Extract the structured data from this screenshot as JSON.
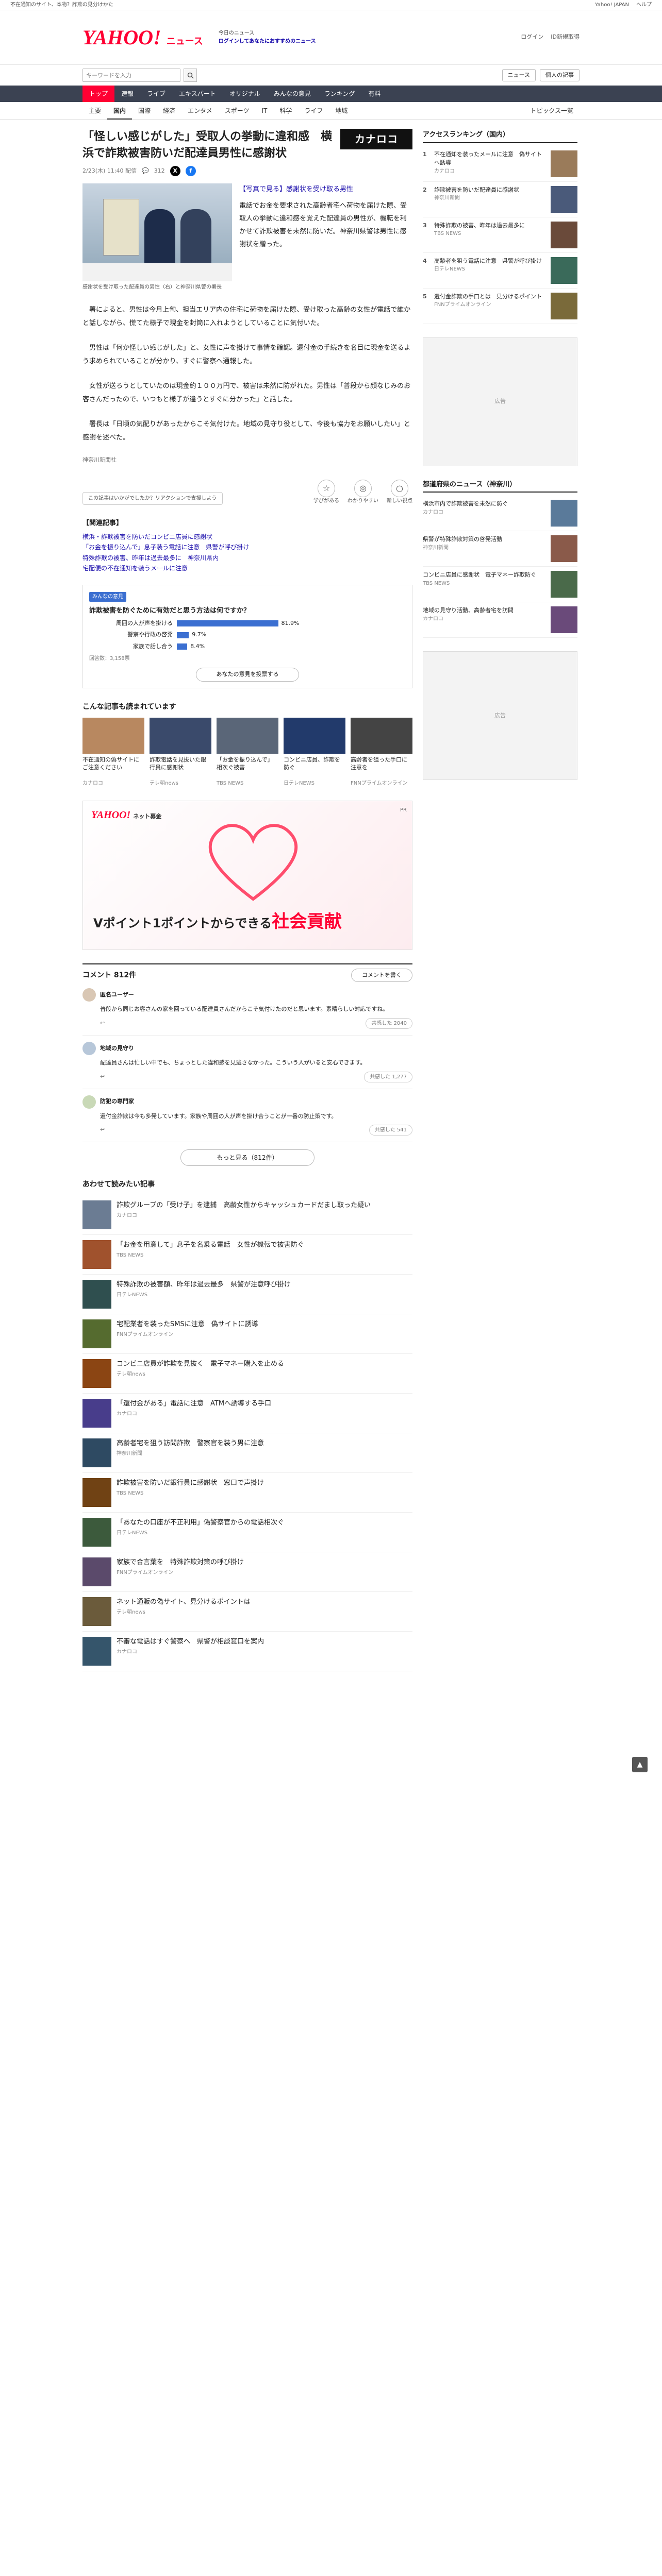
{
  "topbar": {
    "links": [
      "不在通知のサイト、本物？詐欺の見分けかた",
      "Yahoo! JAPAN",
      "ヘルプ"
    ]
  },
  "header": {
    "logo_main": "YAHOO!",
    "logo_sub": "ニュース",
    "promo_line1": "今日のニュース",
    "promo_line2": "ログインしてあなたにおすすめのニュース",
    "links": [
      "ログイン",
      "ID新規取得"
    ]
  },
  "search": {
    "placeholder": "キーワードを入力",
    "buttons": [
      "ニュース",
      "個人の記事"
    ]
  },
  "gnav": [
    "トップ",
    "速報",
    "ライブ",
    "エキスパート",
    "オリジナル",
    "みんなの意見",
    "ランキング",
    "有料"
  ],
  "subnav": [
    "主要",
    "国内",
    "国際",
    "経済",
    "エンタメ",
    "スポーツ",
    "IT",
    "科学",
    "ライフ",
    "地域"
  ],
  "subnav_more": "トピックス一覧",
  "article": {
    "title": "「怪しい感じがした」受取人の挙動に違和感　横浜で詐欺被害防いだ配達員男性に感謝状",
    "title_ad": "カナロコ",
    "date": "2/23(木) 11:40 配信",
    "comments_count_meta": "312",
    "photo_caption": "感謝状を受け取った配達員の男性（右）と神奈川県警の署長",
    "lead": "【写真で見る】感謝状を受け取る男性",
    "lead_text": "電話でお金を要求された高齢者宅へ荷物を届けた際、受取人の挙動に違和感を覚えた配達員の男性が、機転を利かせて詐欺被害を未然に防いだ。神奈川県警は男性に感謝状を贈った。",
    "paragraphs": [
      "署によると、男性は今月上旬、担当エリア内の住宅に荷物を届けた際、受け取った高齢の女性が電話で誰かと話しながら、慌てた様子で現金を封筒に入れようとしていることに気付いた。",
      "男性は「何か怪しい感じがした」と、女性に声を掛けて事情を確認。還付金の手続きを名目に現金を送るよう求められていることが分かり、すぐに警察へ通報した。",
      "女性が送ろうとしていたのは現金約１００万円で、被害は未然に防がれた。男性は「普段から顔なじみのお客さんだったので、いつもと様子が違うとすぐに分かった」と話した。",
      "署長は「日頃の気配りがあったからこそ気付けた。地域の見守り役として、今後も協力をお願いしたい」と感謝を述べた。"
    ],
    "source": "神奈川新聞社",
    "reaction_prompt": "この記事はいかがでしたか？リアクションで支援しよう",
    "reactions": [
      {
        "label": "学びがある",
        "icon": "☆"
      },
      {
        "label": "わかりやすい",
        "icon": "◎"
      },
      {
        "label": "新しい視点",
        "icon": "○"
      }
    ]
  },
  "related": {
    "heading": "【関連記事】",
    "items": [
      "横浜・詐欺被害を防いだコンビニ店員に感謝状",
      "「お金を振り込んで」息子装う電話に注意　県警が呼び掛け",
      "特殊詐欺の被害、昨年は過去最多に　神奈川県内",
      "宅配便の不在通知を装うメールに注意"
    ]
  },
  "poll": {
    "tag": "みんなの意見",
    "question": "詐欺被害を防ぐために有効だと思う方法は何ですか？",
    "options": [
      {
        "label": "周囲の人が声を掛ける",
        "pct": 81.9
      },
      {
        "label": "警察や行政の啓発",
        "pct": 9.7
      },
      {
        "label": "家族で話し合う",
        "pct": 8.4
      }
    ],
    "foot": "回答数：3,158票",
    "button": "あなたの意見を投票する"
  },
  "recs": {
    "heading": "こんな記事も読まれています",
    "items": [
      {
        "title": "不在通知の偽サイトにご注意ください",
        "src": "カナロコ",
        "color": "#b88860"
      },
      {
        "title": "詐欺電話を見抜いた銀行員に感謝状",
        "src": "テレ朝news",
        "color": "#3a4a6b"
      },
      {
        "title": "「お金を振り込んで」相次ぐ被害",
        "src": "TBS NEWS",
        "color": "#5a6678"
      },
      {
        "title": "コンビニ店員、詐欺を防ぐ",
        "src": "日テレNEWS",
        "color": "#223a6b"
      },
      {
        "title": "高齢者を狙った手口に注意を",
        "src": "FNNプライムオンライン",
        "color": "#444"
      }
    ]
  },
  "banner": {
    "brand": "YAHOO!",
    "brand_sub": "ネット募金",
    "tag": "PR",
    "copy_pre": "Vポイント1ポイントからできる",
    "copy_em": "社会貢献"
  },
  "comments": {
    "heading": "コメント 812件",
    "write": "コメントを書く",
    "items": [
      {
        "name": "匿名ユーザー",
        "body": "普段から同じお客さんの家を回っている配達員さんだからこそ気付けたのだと思います。素晴らしい対応ですね。",
        "useful": "共感した 2040"
      },
      {
        "name": "地域の見守り",
        "body": "配達員さんは忙しい中でも、ちょっとした違和感を見逃さなかった。こういう人がいると安心できます。",
        "useful": "共感した 1,277"
      },
      {
        "name": "防犯の専門家",
        "body": "還付金詐欺は今も多発しています。家族や周囲の人が声を掛け合うことが一番の防止策です。",
        "useful": "共感した 541"
      }
    ],
    "more": "もっと見る（812件）"
  },
  "stories": {
    "heading": "あわせて読みたい記事",
    "items": [
      {
        "title": "詐欺グループの「受け子」を逮捕　高齢女性からキャッシュカードだまし取った疑い",
        "src": "カナロコ",
        "color": "#6b7c93"
      },
      {
        "title": "「お金を用意して」息子を名乗る電話　女性が機転で被害防ぐ",
        "src": "TBS NEWS",
        "color": "#a0522d"
      },
      {
        "title": "特殊詐欺の被害額、昨年は過去最多　県警が注意呼び掛け",
        "src": "日テレNEWS",
        "color": "#2f4f4f"
      },
      {
        "title": "宅配業者を装ったSMSに注意　偽サイトに誘導",
        "src": "FNNプライムオンライン",
        "color": "#556b2f"
      },
      {
        "title": "コンビニ店員が詐欺を見抜く　電子マネー購入を止める",
        "src": "テレ朝news",
        "color": "#8b4513"
      },
      {
        "title": "「還付金がある」電話に注意　ATMへ誘導する手口",
        "src": "カナロコ",
        "color": "#483d8b"
      },
      {
        "title": "高齢者宅を狙う訪問詐欺　警察官を装う男に注意",
        "src": "神奈川新聞",
        "color": "#2e4a62"
      },
      {
        "title": "詐欺被害を防いだ銀行員に感謝状　窓口で声掛け",
        "src": "TBS NEWS",
        "color": "#704214"
      },
      {
        "title": "「あなたの口座が不正利用」偽警察官からの電話相次ぐ",
        "src": "日テレNEWS",
        "color": "#3c5a3c"
      },
      {
        "title": "家族で合言葉を　特殊詐欺対策の呼び掛け",
        "src": "FNNプライムオンライン",
        "color": "#5b4a6b"
      },
      {
        "title": "ネット通販の偽サイト、見分けるポイントは",
        "src": "テレ朝news",
        "color": "#6b5b3b"
      },
      {
        "title": "不審な電話はすぐ警察へ　県警が相談窓口を案内",
        "src": "カナロコ",
        "color": "#35556b"
      }
    ]
  },
  "side": {
    "ranking_heading": "アクセスランキング（国内）",
    "ranking": [
      {
        "title": "不在通知を装ったメールに注意　偽サイトへ誘導",
        "src": "カナロコ",
        "color": "#9a7b5a"
      },
      {
        "title": "詐欺被害を防いだ配達員に感謝状",
        "src": "神奈川新聞",
        "color": "#4a5a7a"
      },
      {
        "title": "特殊詐欺の被害、昨年は過去最多に",
        "src": "TBS NEWS",
        "color": "#6a4a3a"
      },
      {
        "title": "高齢者を狙う電話に注意　県警が呼び掛け",
        "src": "日テレNEWS",
        "color": "#3a6a5a"
      },
      {
        "title": "還付金詐欺の手口とは　見分けるポイント",
        "src": "FNNプライムオンライン",
        "color": "#7a6a3a"
      }
    ],
    "ad_label": "広告",
    "local_heading": "都道府県のニュース（神奈川）",
    "local": [
      {
        "title": "横浜市内で詐欺被害を未然に防ぐ",
        "src": "カナロコ",
        "color": "#5a7a9a"
      },
      {
        "title": "県警が特殊詐欺対策の啓発活動",
        "src": "神奈川新聞",
        "color": "#8a5a4a"
      },
      {
        "title": "コンビニ店員に感謝状　電子マネー詐欺防ぐ",
        "src": "TBS NEWS",
        "color": "#4a6a4a"
      },
      {
        "title": "地域の見守り活動、高齢者宅を訪問",
        "src": "カナロコ",
        "color": "#6a4a7a"
      }
    ]
  },
  "backtop": "▲"
}
